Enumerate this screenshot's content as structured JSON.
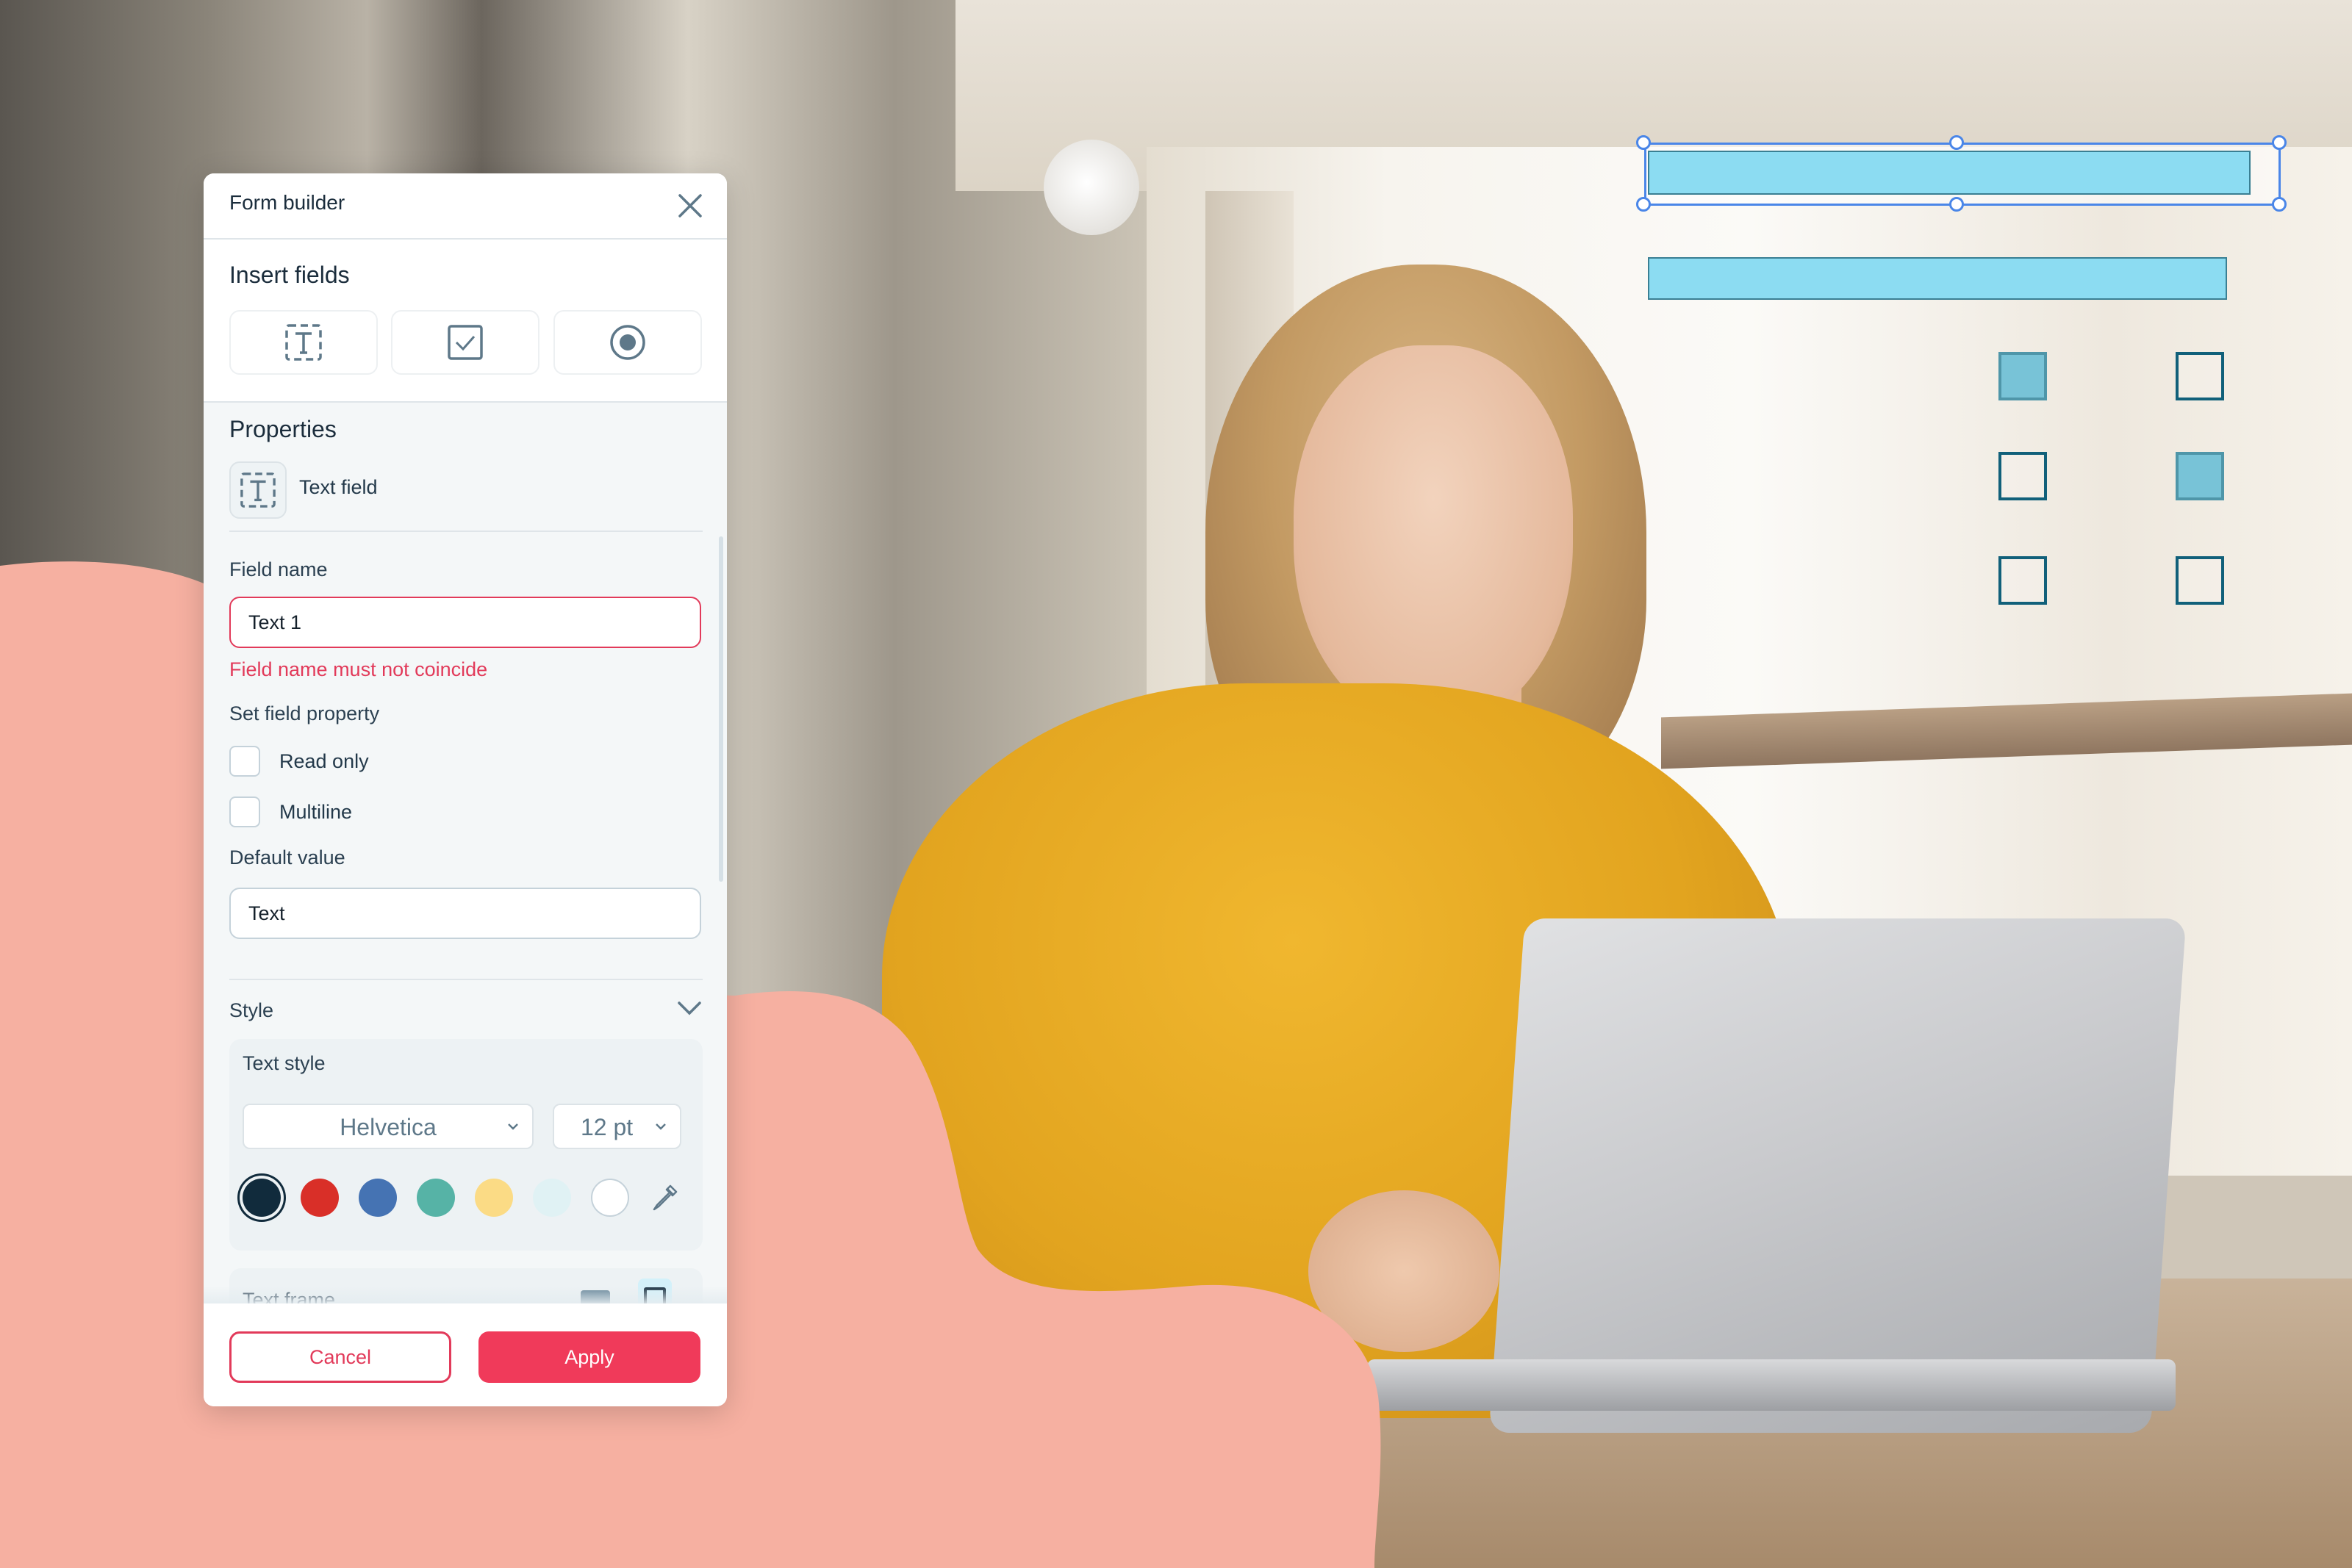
{
  "panel": {
    "title": "Form builder",
    "close_icon": "close-icon",
    "insert_fields": {
      "title": "Insert fields",
      "buttons": [
        {
          "icon": "text-field-icon",
          "label": "Text field"
        },
        {
          "icon": "checkbox-icon",
          "label": "Checkbox"
        },
        {
          "icon": "radio-button-icon",
          "label": "Radio button"
        }
      ]
    },
    "properties": {
      "title": "Properties",
      "field_type": {
        "icon": "text-field-icon",
        "label": "Text field"
      },
      "field_name": {
        "label": "Field name",
        "value": "Text 1",
        "error": "Field name must not coincide"
      },
      "set_field_property": {
        "label": "Set field property",
        "options": [
          {
            "label": "Read only",
            "checked": false
          },
          {
            "label": "Multiline",
            "checked": false
          }
        ]
      },
      "default_value": {
        "label": "Default value",
        "value": "Text"
      }
    },
    "style": {
      "label": "Style",
      "expanded": true,
      "text_style": {
        "label": "Text style",
        "font": "Helvetica",
        "size": "12 pt",
        "colors": [
          {
            "name": "navy",
            "hex": "#112b3c",
            "selected": true
          },
          {
            "name": "red",
            "hex": "#d92f28",
            "selected": false
          },
          {
            "name": "blue",
            "hex": "#4573b3",
            "selected": false
          },
          {
            "name": "teal",
            "hex": "#56b3a6",
            "selected": false
          },
          {
            "name": "yellow",
            "hex": "#fbdb85",
            "selected": false
          },
          {
            "name": "light-cyan",
            "hex": "#e0f2f4",
            "selected": false
          },
          {
            "name": "white",
            "hex": "#ffffff",
            "selected": false
          }
        ],
        "eyedropper_icon": "eyedropper-icon"
      },
      "text_frame": {
        "label": "Text frame",
        "options": [
          {
            "name": "filled",
            "selected": false
          },
          {
            "name": "outline",
            "selected": true
          }
        ]
      }
    },
    "footer": {
      "cancel": "Cancel",
      "apply": "Apply"
    }
  },
  "colors": {
    "accent": "#f03a5a",
    "error": "#e23a5a",
    "blob": "#f6b0a1",
    "selection": "#4a86e8",
    "deco_fill": "#8cdcf2",
    "deco_box_fill": "#78c3d7",
    "deco_box_border": "#11607a"
  },
  "decor": {
    "text_fields": [
      {
        "selected": true
      },
      {
        "selected": false
      }
    ],
    "checkbox_grid": [
      [
        true,
        false
      ],
      [
        false,
        true
      ],
      [
        false,
        false
      ]
    ]
  }
}
